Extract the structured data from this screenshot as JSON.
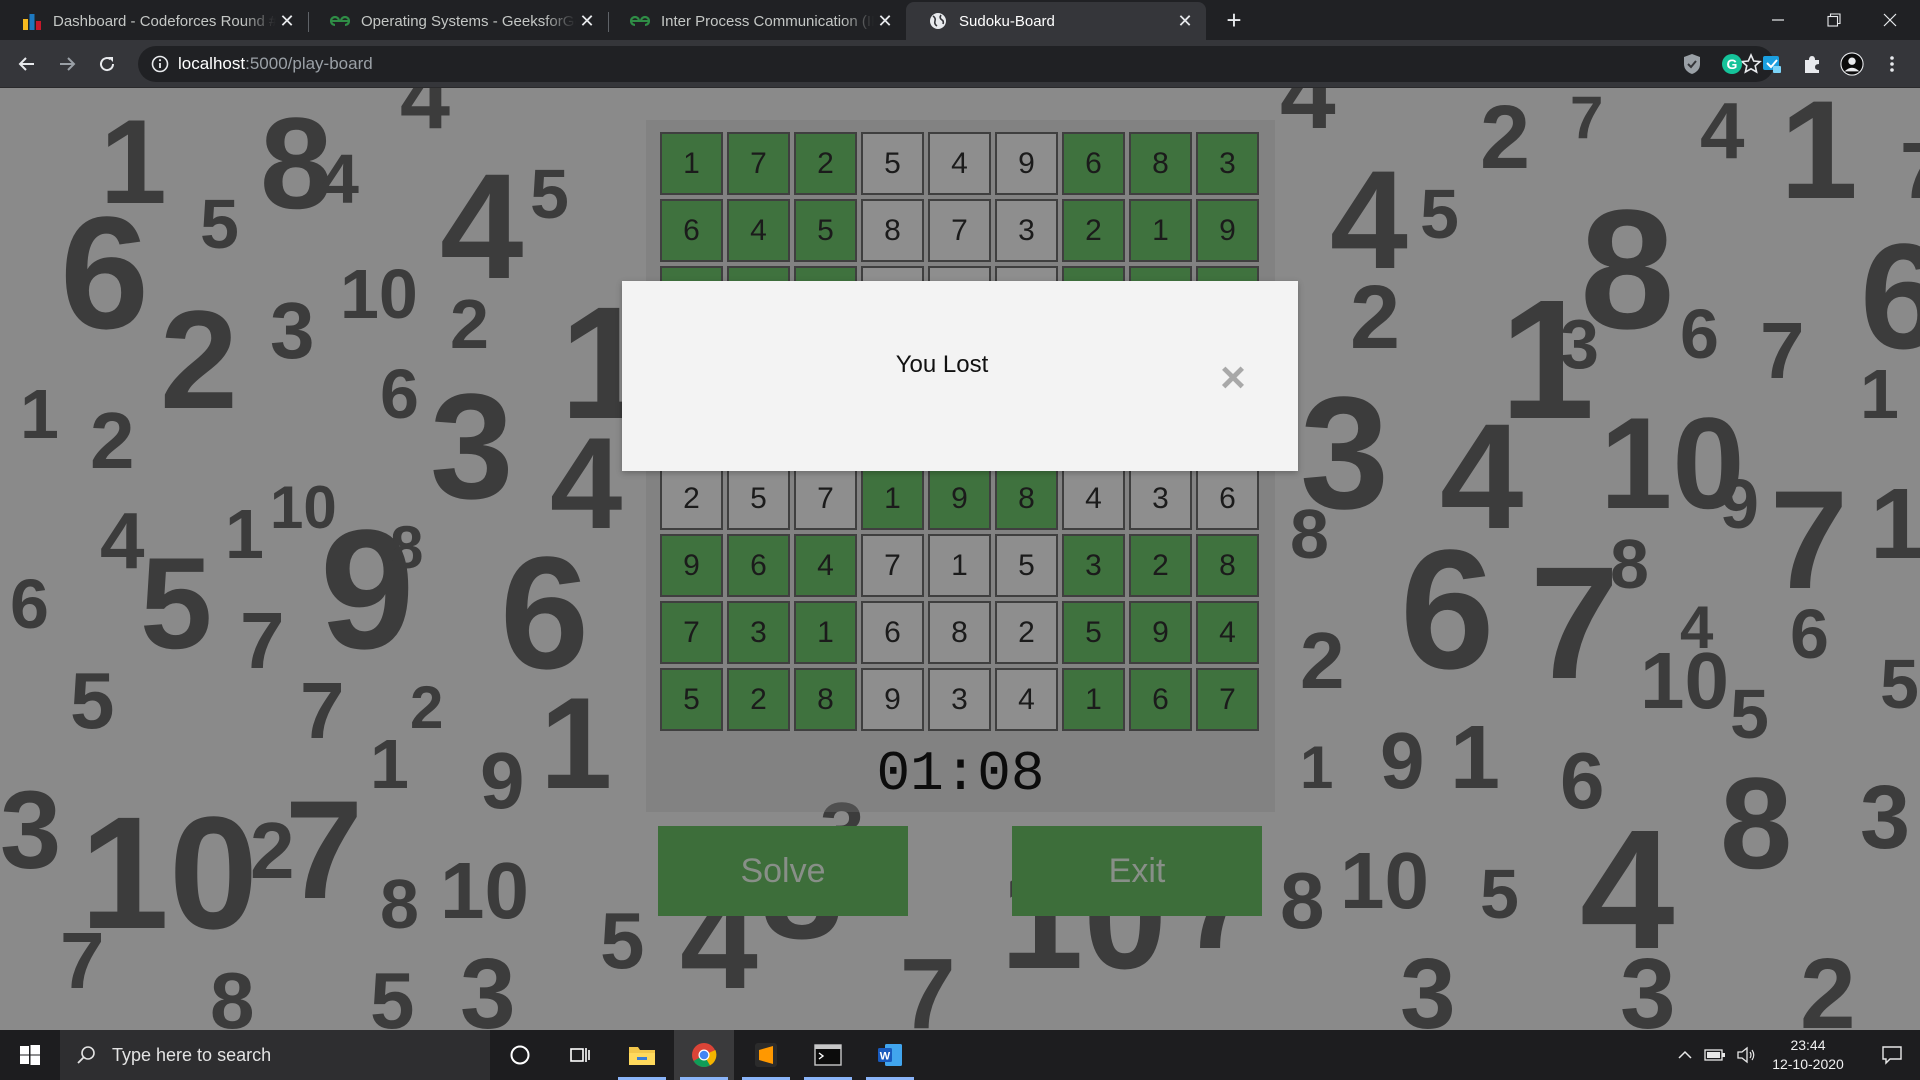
{
  "browser": {
    "tabs": [
      {
        "title": "Dashboard - Codeforces Round #",
        "icon": "codeforces-icon",
        "active": false
      },
      {
        "title": "Operating Systems - GeeksforGeeks",
        "icon": "geeksforgeeks-icon",
        "active": false
      },
      {
        "title": "Inter Process Communication (IPC)",
        "icon": "geeksforgeeks-icon",
        "active": false
      },
      {
        "title": "Sudoku-Board",
        "icon": "globe-icon",
        "active": true
      }
    ],
    "new_tab_label": "+",
    "address": {
      "host": "localhost",
      "path": ":5000/play-board"
    }
  },
  "game": {
    "rows": [
      [
        1,
        7,
        2,
        5,
        4,
        9,
        6,
        8,
        3
      ],
      [
        6,
        4,
        5,
        8,
        7,
        3,
        2,
        1,
        9
      ],
      [
        0,
        0,
        0,
        0,
        0,
        0,
        0,
        0,
        0
      ],
      [
        0,
        0,
        0,
        0,
        0,
        0,
        0,
        0,
        0
      ],
      [
        0,
        0,
        0,
        0,
        0,
        0,
        0,
        0,
        0
      ],
      [
        2,
        5,
        7,
        1,
        9,
        8,
        4,
        3,
        6
      ],
      [
        9,
        6,
        4,
        7,
        1,
        5,
        3,
        2,
        8
      ],
      [
        7,
        3,
        1,
        6,
        8,
        2,
        5,
        9,
        4
      ],
      [
        5,
        2,
        8,
        9,
        3,
        4,
        1,
        6,
        7
      ]
    ],
    "given_mask": [
      [
        1,
        1,
        1,
        0,
        0,
        0,
        1,
        1,
        1
      ],
      [
        1,
        1,
        1,
        0,
        0,
        0,
        1,
        1,
        1
      ],
      [
        1,
        1,
        1,
        0,
        0,
        0,
        1,
        1,
        1
      ],
      [
        0,
        0,
        0,
        1,
        1,
        1,
        0,
        0,
        0
      ],
      [
        0,
        0,
        0,
        1,
        1,
        1,
        0,
        0,
        0
      ],
      [
        0,
        0,
        0,
        1,
        1,
        1,
        0,
        0,
        0
      ],
      [
        1,
        1,
        1,
        0,
        0,
        0,
        1,
        1,
        1
      ],
      [
        1,
        1,
        1,
        0,
        0,
        0,
        1,
        1,
        1
      ],
      [
        1,
        1,
        1,
        0,
        0,
        0,
        1,
        1,
        1
      ]
    ],
    "timer": "01:08",
    "solve_label": "Solve",
    "exit_label": "Exit"
  },
  "modal": {
    "message": "You Lost",
    "close_label": "×"
  },
  "taskbar": {
    "search_placeholder": "Type here to search",
    "time": "23:44",
    "date": "12-10-2020"
  },
  "colors": {
    "cell_given": "#3f723e",
    "cell_blank": "#8e8e8e",
    "button": "#3d6e3a",
    "modal_bg": "#f3f3f3"
  }
}
